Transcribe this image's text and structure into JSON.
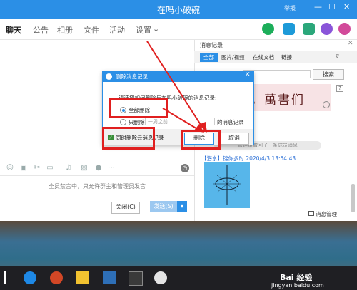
{
  "window": {
    "title": "在吗小破碗",
    "titlebar_right": "举报",
    "controls": [
      "—",
      "☐",
      "✕"
    ]
  },
  "tabs": [
    {
      "label": "聊天",
      "active": true
    },
    {
      "label": "公告",
      "active": false
    },
    {
      "label": "相册",
      "active": false
    },
    {
      "label": "文件",
      "active": false
    },
    {
      "label": "活动",
      "active": false
    },
    {
      "label": "设置",
      "active": false
    }
  ],
  "tab_dropdown_glyph": "⌄",
  "chat": {
    "muted_notice": "全员禁言中，只允许群主和管理员发言",
    "close_label": "关闭(C)",
    "send_label": "发送(S)",
    "send_dropdown": "▾"
  },
  "toolbar_icons": [
    "smile-icon",
    "gif-icon",
    "scissors-icon",
    "folder-icon",
    "image-icon",
    "music-icon",
    "picture-icon",
    "mic-icon",
    "more-icon",
    "history-icon"
  ],
  "records_panel": {
    "title": "消息记录",
    "close": "✕",
    "tabs": [
      {
        "label": "全部",
        "active": true
      },
      {
        "label": "图片/视频",
        "active": false
      },
      {
        "label": "在线文档",
        "active": false
      },
      {
        "label": "链接",
        "active": false
      }
    ],
    "search_button": "搜索",
    "help": "?",
    "banner_text": "安，萬書们",
    "system_message": "管理员撤回了一条成员消息",
    "message_header": "【潜水】锦你多时 2020/4/3 13:54:43",
    "manage_label": "消息管理"
  },
  "dialog": {
    "title": "删除消息记录",
    "close": "✕",
    "question": "请选择如何删除与在吗小破碗的消息记录:",
    "option_all": "全部删除",
    "option_partial": "只删除",
    "partial_select": "一周之前",
    "partial_suffix": "的消息记录",
    "checkbox_label": "同时删除云消息记录",
    "checkbox_checked": true,
    "delete_label": "删除",
    "cancel_label": "取消",
    "selected_option": "all"
  },
  "watermark": {
    "brand": "Bai 经验",
    "url": "jingyan.baidu.com"
  },
  "colors": {
    "accent": "#2b8fe6",
    "annotation_red": "#e01f1f"
  }
}
